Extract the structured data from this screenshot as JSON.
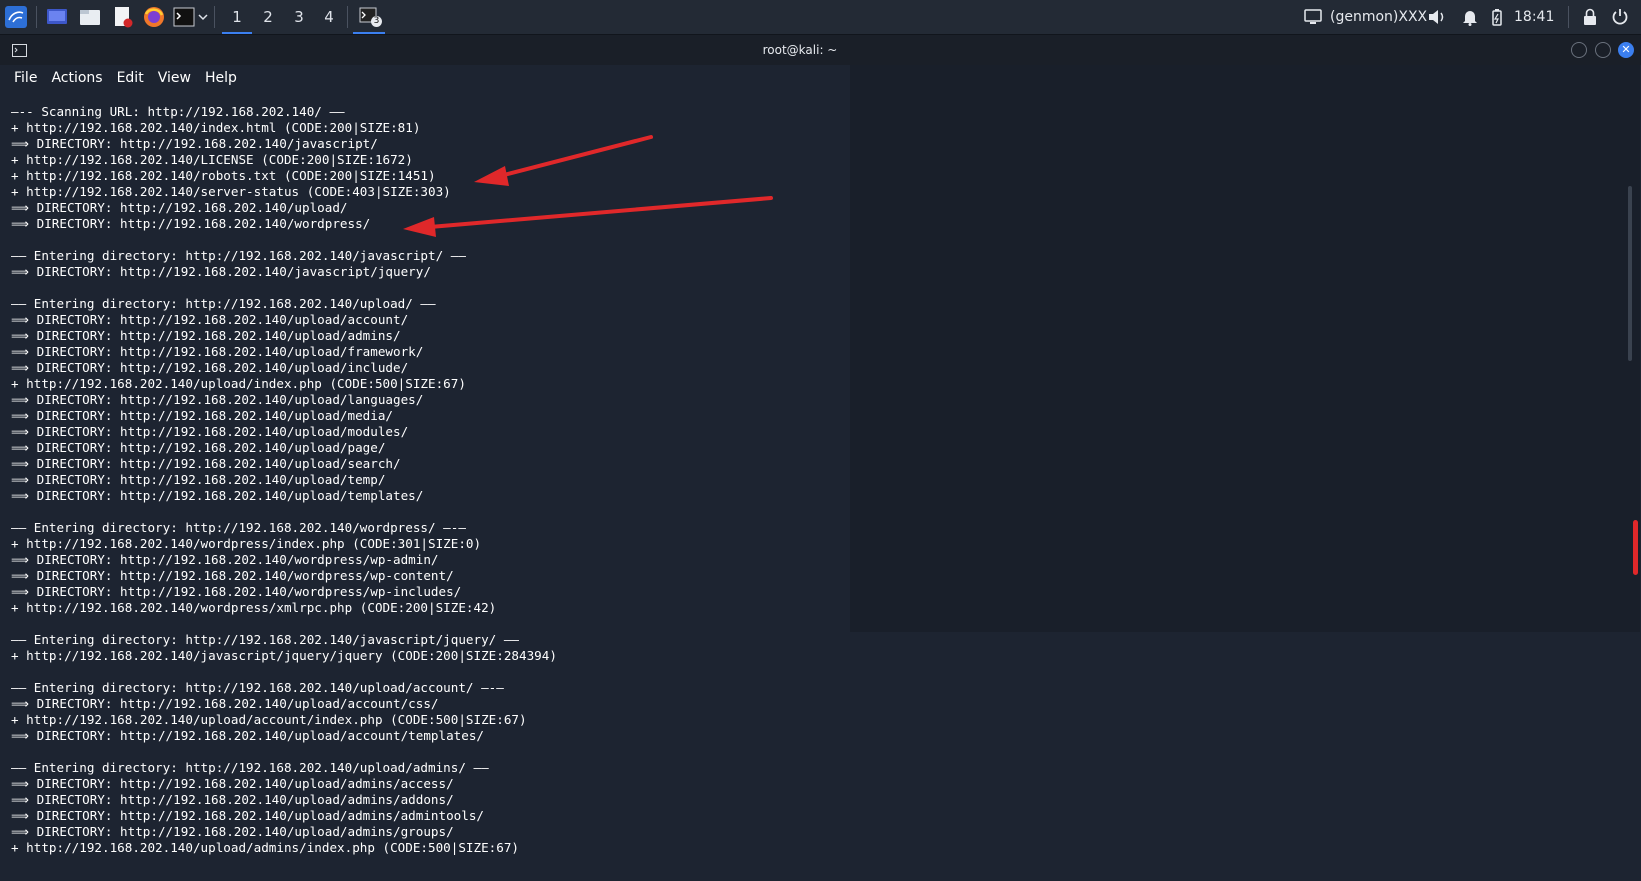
{
  "taskbar": {
    "workspaces": [
      "1",
      "2",
      "3",
      "4"
    ],
    "genmon": "(genmon)XXX",
    "clock": "18:41",
    "taskbar_badge": "3"
  },
  "window": {
    "title": "root@kali: ~"
  },
  "menu": [
    "File",
    "Actions",
    "Edit",
    "View",
    "Help"
  ],
  "terminal_lines": [
    "—-- Scanning URL: http://192.168.202.140/ ——",
    "+ http://192.168.202.140/index.html (CODE:200|SIZE:81)",
    "⟹ DIRECTORY: http://192.168.202.140/javascript/",
    "+ http://192.168.202.140/LICENSE (CODE:200|SIZE:1672)",
    "+ http://192.168.202.140/robots.txt (CODE:200|SIZE:1451)",
    "+ http://192.168.202.140/server-status (CODE:403|SIZE:303)",
    "⟹ DIRECTORY: http://192.168.202.140/upload/",
    "⟹ DIRECTORY: http://192.168.202.140/wordpress/",
    "",
    "—— Entering directory: http://192.168.202.140/javascript/ ——",
    "⟹ DIRECTORY: http://192.168.202.140/javascript/jquery/",
    "",
    "—— Entering directory: http://192.168.202.140/upload/ ——",
    "⟹ DIRECTORY: http://192.168.202.140/upload/account/",
    "⟹ DIRECTORY: http://192.168.202.140/upload/admins/",
    "⟹ DIRECTORY: http://192.168.202.140/upload/framework/",
    "⟹ DIRECTORY: http://192.168.202.140/upload/include/",
    "+ http://192.168.202.140/upload/index.php (CODE:500|SIZE:67)",
    "⟹ DIRECTORY: http://192.168.202.140/upload/languages/",
    "⟹ DIRECTORY: http://192.168.202.140/upload/media/",
    "⟹ DIRECTORY: http://192.168.202.140/upload/modules/",
    "⟹ DIRECTORY: http://192.168.202.140/upload/page/",
    "⟹ DIRECTORY: http://192.168.202.140/upload/search/",
    "⟹ DIRECTORY: http://192.168.202.140/upload/temp/",
    "⟹ DIRECTORY: http://192.168.202.140/upload/templates/",
    "",
    "—— Entering directory: http://192.168.202.140/wordpress/ —-—",
    "+ http://192.168.202.140/wordpress/index.php (CODE:301|SIZE:0)",
    "⟹ DIRECTORY: http://192.168.202.140/wordpress/wp-admin/",
    "⟹ DIRECTORY: http://192.168.202.140/wordpress/wp-content/",
    "⟹ DIRECTORY: http://192.168.202.140/wordpress/wp-includes/",
    "+ http://192.168.202.140/wordpress/xmlrpc.php (CODE:200|SIZE:42)",
    "",
    "—— Entering directory: http://192.168.202.140/javascript/jquery/ ——",
    "+ http://192.168.202.140/javascript/jquery/jquery (CODE:200|SIZE:284394)",
    "",
    "—— Entering directory: http://192.168.202.140/upload/account/ —-—",
    "⟹ DIRECTORY: http://192.168.202.140/upload/account/css/",
    "+ http://192.168.202.140/upload/account/index.php (CODE:500|SIZE:67)",
    "⟹ DIRECTORY: http://192.168.202.140/upload/account/templates/",
    "",
    "—— Entering directory: http://192.168.202.140/upload/admins/ ——",
    "⟹ DIRECTORY: http://192.168.202.140/upload/admins/access/",
    "⟹ DIRECTORY: http://192.168.202.140/upload/admins/addons/",
    "⟹ DIRECTORY: http://192.168.202.140/upload/admins/admintools/",
    "⟹ DIRECTORY: http://192.168.202.140/upload/admins/groups/",
    "+ http://192.168.202.140/upload/admins/index.php (CODE:500|SIZE:67)"
  ],
  "colors": {
    "terminal_bg": "#1d2431",
    "terminal_fg": "#ffffff",
    "annotation_arrow": "#e0282a",
    "accent": "#3b7ff0"
  }
}
